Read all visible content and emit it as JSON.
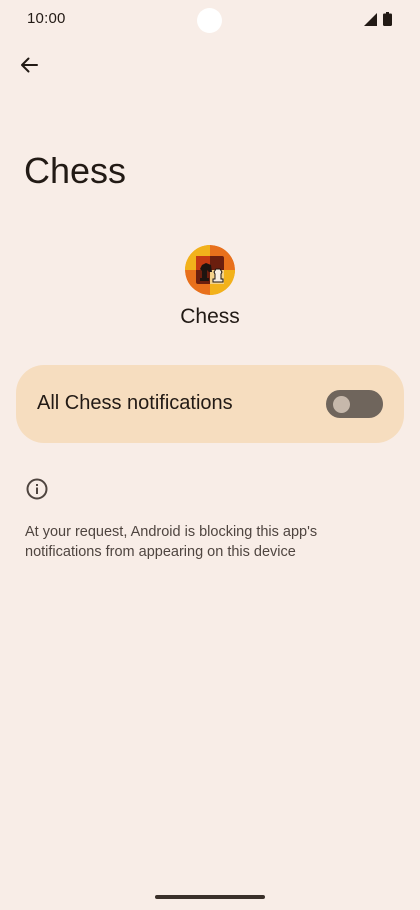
{
  "status_bar": {
    "time": "10:00",
    "icons": [
      "signal-icon",
      "battery-icon"
    ]
  },
  "toolbar": {
    "back_icon": "arrow-back-icon"
  },
  "page": {
    "title": "Chess"
  },
  "app": {
    "name": "Chess",
    "icon": "chess-app-icon"
  },
  "notifications_toggle": {
    "label": "All Chess notifications",
    "state": "off"
  },
  "info": {
    "icon": "info-icon",
    "text": "At your request, Android is blocking this app's notifications from appearing on this device"
  },
  "colors": {
    "background": "#f8ede7",
    "card": "#f6ddbf",
    "switch_track_off": "#6f655c",
    "switch_thumb_off": "#c6b8ab",
    "text_primary": "#221a15",
    "text_secondary": "#4f4540"
  }
}
